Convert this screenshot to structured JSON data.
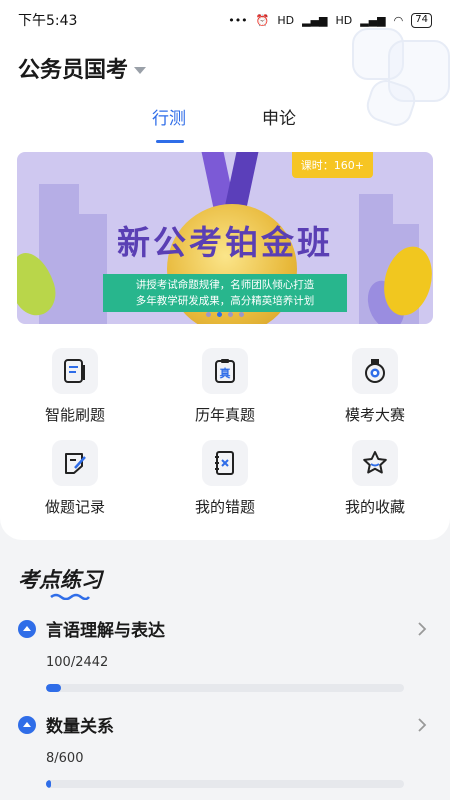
{
  "status_bar": {
    "time": "下午5:43",
    "signal1": "HD",
    "signal2": "HD",
    "battery": "74"
  },
  "header": {
    "exam_select": "公务员国考"
  },
  "tabs": [
    {
      "label": "行测",
      "active": true
    },
    {
      "label": "申论",
      "active": false
    }
  ],
  "banner": {
    "title": "新公考铂金班",
    "tag": "课时：160+",
    "desc_line1": "讲授考试命题规律，名师团队倾心打造",
    "desc_line2": "多年教学研发成果，高分精英培养计划",
    "dots_total": 4,
    "dot_active_index": 1
  },
  "functions": [
    {
      "label": "智能刷题",
      "icon": "smart-practice-icon"
    },
    {
      "label": "历年真题",
      "icon": "past-papers-icon",
      "glyph": "真"
    },
    {
      "label": "模考大赛",
      "icon": "mock-exam-medal-icon"
    },
    {
      "label": "做题记录",
      "icon": "practice-record-icon"
    },
    {
      "label": "我的错题",
      "icon": "wrong-questions-icon"
    },
    {
      "label": "我的收藏",
      "icon": "favorites-star-icon"
    }
  ],
  "practice": {
    "title": "考点练习",
    "topics": [
      {
        "name": "言语理解与表达",
        "done": 100,
        "total": 2442,
        "progress_text": "100/2442",
        "progress": 0.041
      },
      {
        "name": "数量关系",
        "done": 8,
        "total": 600,
        "progress_text": "8/600",
        "progress": 0.013
      }
    ]
  },
  "colors": {
    "accent": "#2f6de8",
    "banner_purple": "#5a3fb4",
    "tag_yellow": "#f6c523",
    "desc_green": "#28b68d"
  }
}
